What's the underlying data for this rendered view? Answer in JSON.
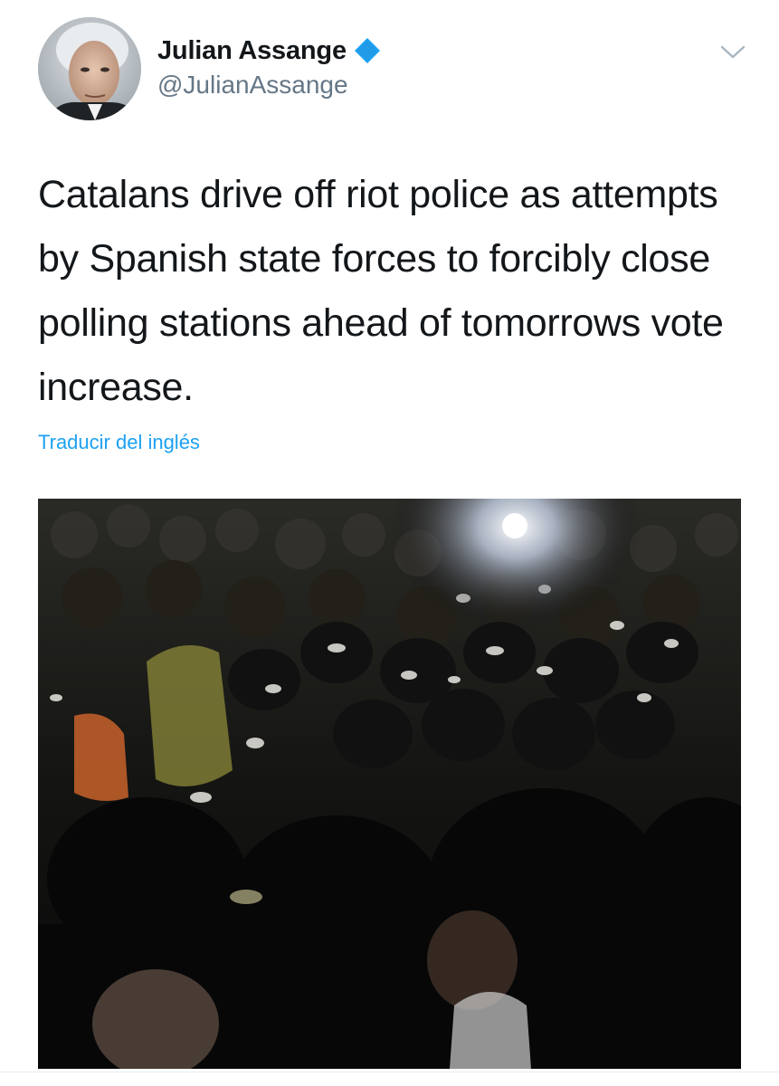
{
  "tweet": {
    "author": {
      "display_name": "Julian Assange",
      "handle": "@JulianAssange",
      "verified": true,
      "avatar_icon": "profile-photo"
    },
    "text": "Catalans drive off riot police as attempts by Spanish state forces to forcibly close polling stations ahead of tomorrows vote increase.",
    "translate_label": "Traducir del inglés",
    "media": {
      "type": "video-still",
      "description_icon": "crowd-riot-photo"
    },
    "menu_icon": "chevron-down-icon"
  },
  "colors": {
    "text_primary": "#14171a",
    "text_secondary": "#657786",
    "link": "#1da1f2",
    "verified_badge": "#1da1f2",
    "caret": "#aab8c2"
  }
}
